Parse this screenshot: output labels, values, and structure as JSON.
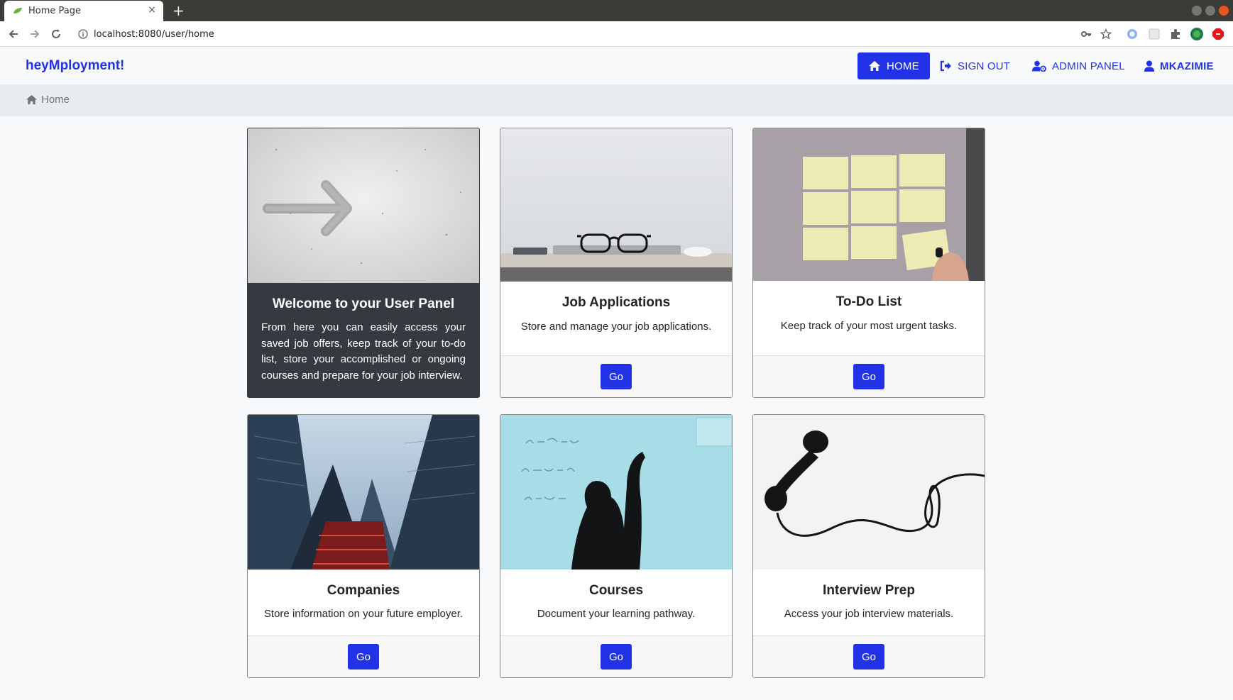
{
  "browser": {
    "tab_title": "Home Page",
    "tab_close": "×",
    "new_tab": "+",
    "url_host": "localhost",
    "url_rest": ":8080/user/home"
  },
  "app": {
    "brand": "heyMployment!",
    "nav": {
      "home": "HOME",
      "sign_out": "SIGN OUT",
      "admin_panel": "ADMIN PANEL",
      "user": "MKAZIMIE"
    },
    "breadcrumb": "Home"
  },
  "colors": {
    "accent": "#2232e6",
    "dark_card": "#343a40",
    "breadcrumb_bg": "#e9ecef"
  },
  "cards": [
    {
      "title": "Welcome to your User Panel",
      "text": "From here you can easily access your saved job offers, keep track of your to-do list, store your accomplished or ongoing courses and prepare for your job interview.",
      "image": "arrow-icon"
    },
    {
      "title": "Job Applications",
      "text": "Store and manage your job applications.",
      "button": "Go",
      "image": "glasses-laptop"
    },
    {
      "title": "To-Do List",
      "text": "Keep track of your most urgent tasks.",
      "button": "Go",
      "image": "sticky-notes"
    },
    {
      "title": "Companies",
      "text": "Store information on your future employer.",
      "button": "Go",
      "image": "skyscrapers"
    },
    {
      "title": "Courses",
      "text": "Document your learning pathway.",
      "button": "Go",
      "image": "blackboard"
    },
    {
      "title": "Interview Prep",
      "text": "Access your job interview materials.",
      "button": "Go",
      "image": "telephone"
    }
  ]
}
